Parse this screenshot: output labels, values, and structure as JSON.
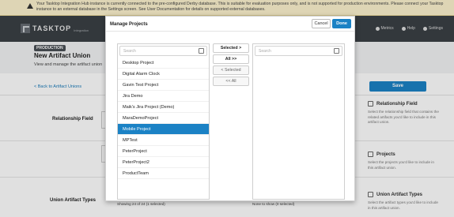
{
  "banner": {
    "text": "Your Tasktop Integration Hub instance is currently connected to the pre-configured Derby database. This is suitable for evaluation purposes only, and is not supported for production environments. Please connect your Tasktop instance to an external database in the Settings screen. See User Documentation for details on supported external databases."
  },
  "nav": {
    "logo": "TASKTOP",
    "logo_sub": "Integration",
    "items": [
      "Metrics",
      "Help",
      "Settings"
    ]
  },
  "page": {
    "badge": "PRODUCTION",
    "title": "New Artifact Union",
    "subtitle": "View and manage the artifact union",
    "back": "< Back to Artifact Unions",
    "save": "Save",
    "field_relationship": "Relationship Field",
    "field_union_types": "Union Artifact Types"
  },
  "help": [
    {
      "title": "Relationship Field",
      "desc": "Select the relationship field that contains the related artifacts you'd like to include in this artifact union.",
      "icon": "relationship-icon"
    },
    {
      "title": "Projects",
      "desc": "Select the projects you'd like to include in this artifact union.",
      "icon": "folder-icon"
    },
    {
      "title": "Union Artifact Types",
      "desc": "Select the artifact types you'd like to include in this artifact union.",
      "icon": "document-icon"
    }
  ],
  "modal": {
    "title": "Manage Projects",
    "cancel": "Cancel",
    "done": "Done",
    "left_search_placeholder": "Search",
    "right_search_placeholder": "Search",
    "buttons": {
      "selected": "Selected >",
      "all": "All >>",
      "unselected": "< Selected",
      "remove_all": "<< All"
    },
    "available": [
      {
        "label": "Desktop Project",
        "selected": false
      },
      {
        "label": "Digital Alarm Clock",
        "selected": false
      },
      {
        "label": "Gavin Test Project",
        "selected": false
      },
      {
        "label": "Jira Demo",
        "selected": false
      },
      {
        "label": "Maik's Jira Project (Demo)",
        "selected": false
      },
      {
        "label": "MaraDemoProject",
        "selected": false
      },
      {
        "label": "Mobile Project",
        "selected": true
      },
      {
        "label": "MPTest",
        "selected": false
      },
      {
        "label": "PeterProject",
        "selected": false
      },
      {
        "label": "PeterProject2",
        "selected": false
      },
      {
        "label": "ProductTeam",
        "selected": false
      }
    ],
    "left_footer": "Showing 24 of 24 (1 selected)",
    "right_footer": "None to show (0 selected)"
  }
}
